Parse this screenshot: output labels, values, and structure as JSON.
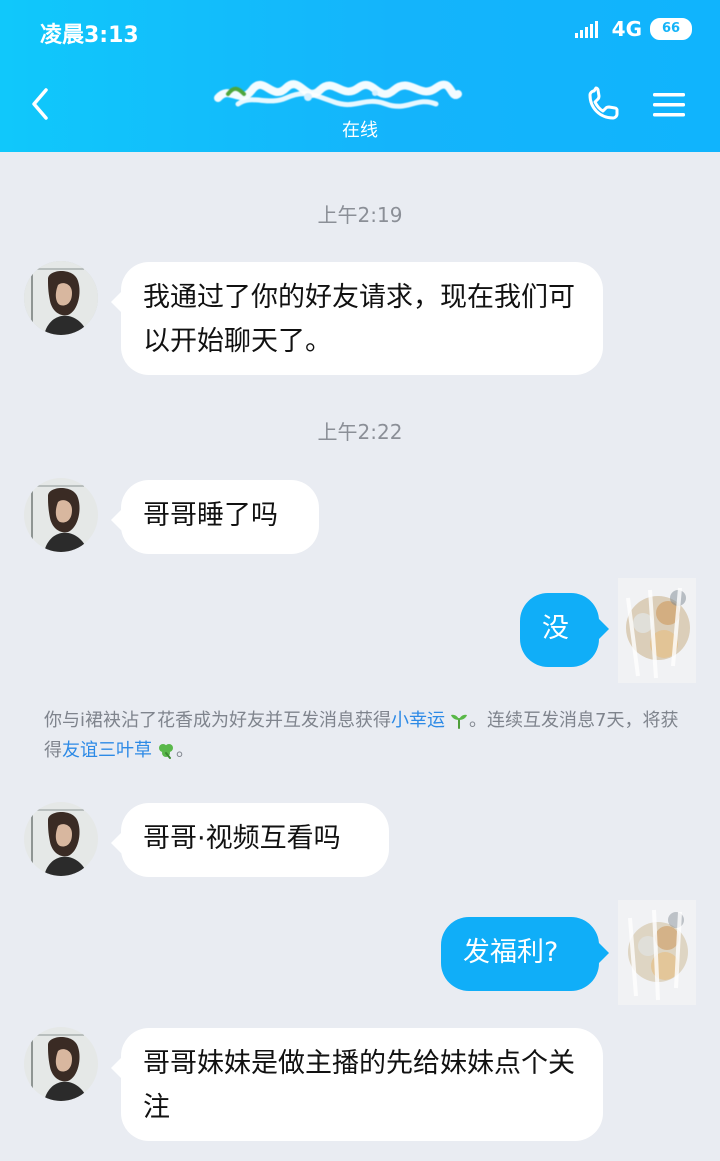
{
  "status_bar": {
    "time": "凌晨3:13",
    "network": "4G",
    "battery": "66"
  },
  "header": {
    "contact_status": "在线"
  },
  "messages": {
    "time_1": "上午2:19",
    "msg_1": "我通过了你的好友请求，现在我们可以开始聊天了。",
    "time_2": "上午2:22",
    "msg_2": "哥哥睡了吗",
    "reply_1": "没",
    "msg_3": "哥哥·视频互看吗",
    "reply_2": "发福利?",
    "msg_4": "哥哥妹妹是做主播的先给妹妹点个关注"
  },
  "system_note": {
    "part_1": "你与i裙袂沾了花香成为好友并互发消息获得",
    "link_1": "小幸运",
    "part_2": "。连续互发消息7天，将获得",
    "link_2": "友谊三叶草",
    "part_3": "。"
  },
  "icons": {
    "back": "chevron-left-icon",
    "phone": "phone-icon",
    "menu": "menu-icon",
    "sprout": "sprout-icon",
    "clover": "clover-icon"
  },
  "colors": {
    "header": "#14b4fb",
    "self_bubble": "#10aef8",
    "link": "#2d8ae6"
  }
}
